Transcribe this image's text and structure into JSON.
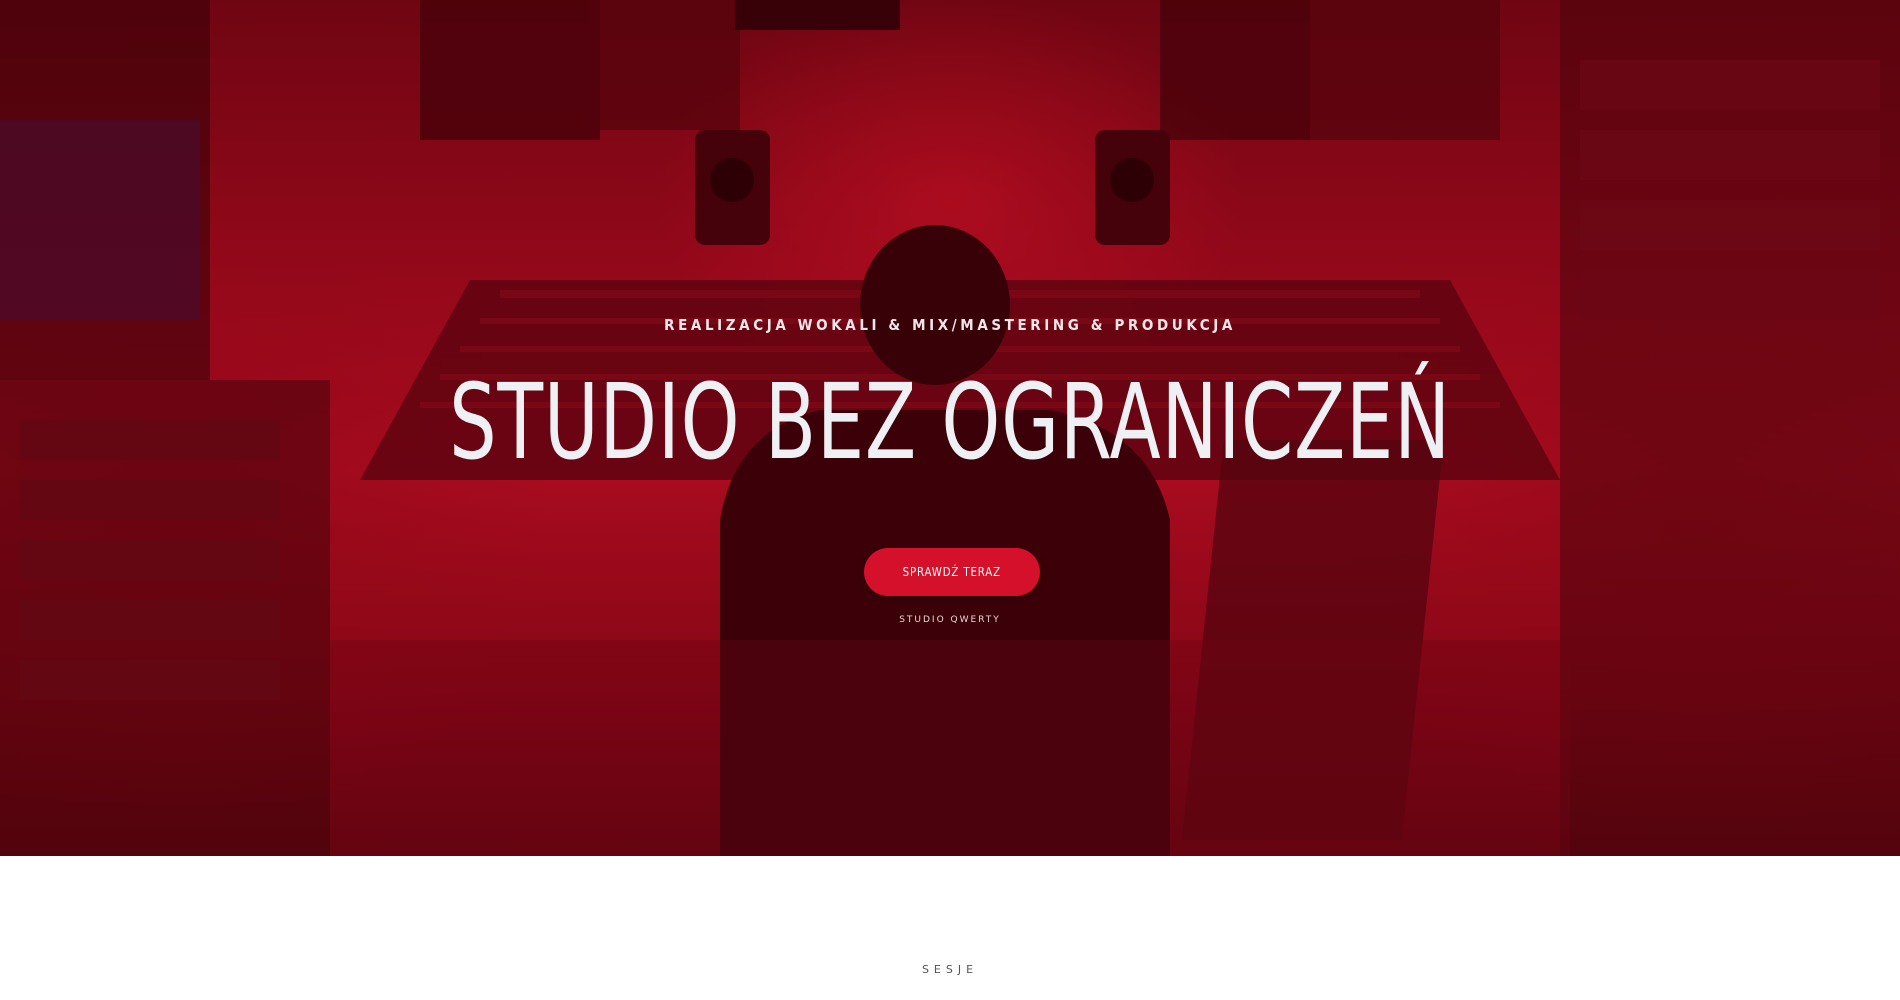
{
  "hero": {
    "tagline": "REALIZACJA WOKALI & MIX/MASTERING & PRODUKCJA",
    "headline": "STUDIO BEZ OGRANICZEŃ",
    "cta_label": "SPRAWDŹ TERAZ",
    "caption": "STUDIO QWERTY",
    "accent_color": "#d4102a"
  },
  "next_section": {
    "label": "SESJE"
  }
}
